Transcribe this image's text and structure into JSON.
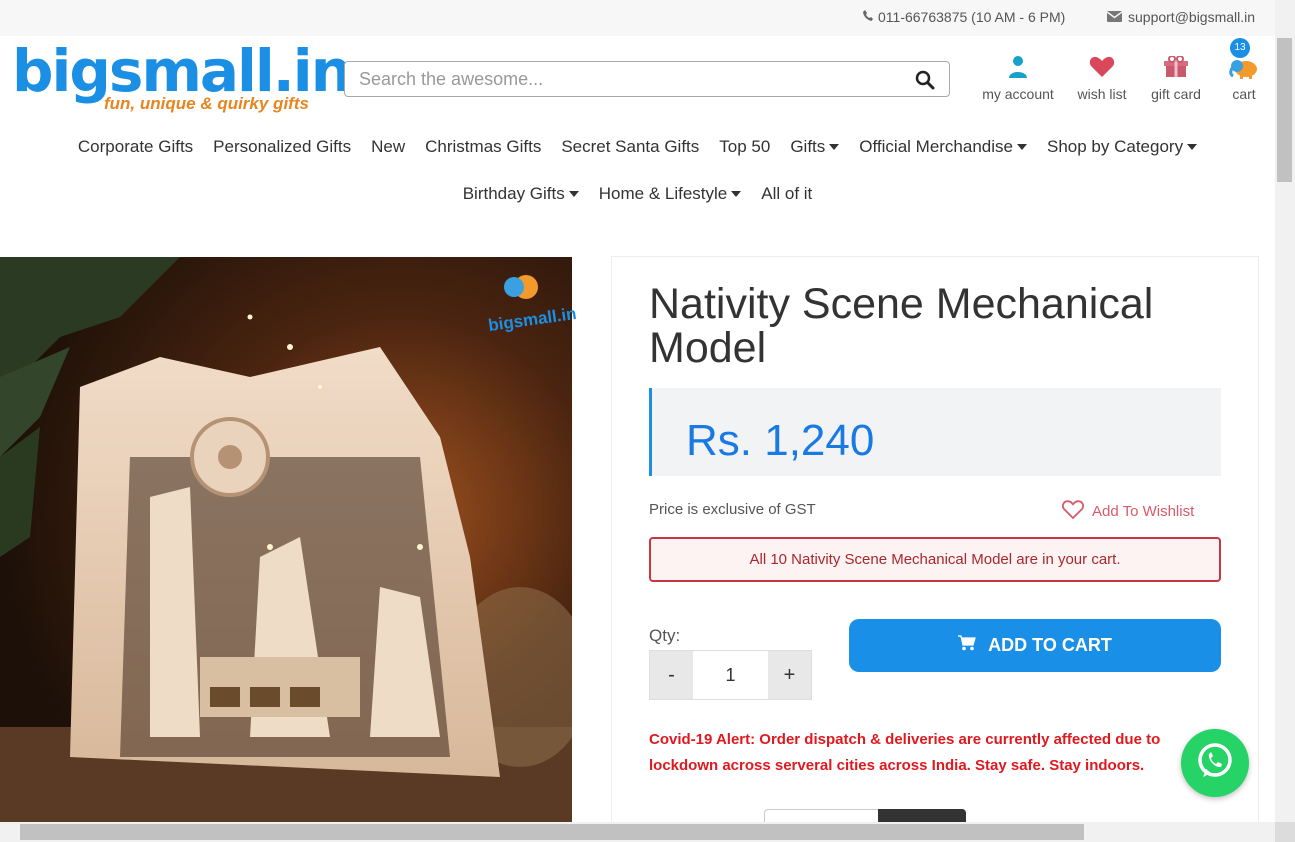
{
  "topbar": {
    "phone": "011-66763875 (10 AM - 6 PM)",
    "email": "support@bigsmall.in"
  },
  "logo": {
    "brand": "bigsmall.in",
    "tagline": "fun, unique & quirky gifts"
  },
  "search": {
    "placeholder": "Search the awesome..."
  },
  "header_icons": {
    "account": "my account",
    "wishlist": "wish list",
    "giftcard": "gift card",
    "cart": "cart",
    "cart_count": "13"
  },
  "nav": {
    "row1": [
      "Corporate Gifts",
      "Personalized Gifts",
      "New",
      "Christmas Gifts",
      "Secret Santa Gifts",
      "Top 50",
      "Gifts",
      "Official Merchandise",
      "Shop by Category"
    ],
    "row2": [
      "Birthday Gifts",
      "Home & Lifestyle",
      "All of it"
    ]
  },
  "product": {
    "image_watermark": "bigsmall.in",
    "title": "Nativity Scene Mechanical Model",
    "price": "Rs. 1,240",
    "gst_note": "Price is exclusive of GST",
    "wishlist": "Add To Wishlist",
    "cart_alert": "All 10 Nativity Scene Mechanical Model are in your cart.",
    "qty_label": "Qty:",
    "qty_minus": "-",
    "qty_value": "1",
    "qty_plus": "+",
    "add_to_cart": "ADD TO CART",
    "covid_alert": "Covid-19 Alert: Order dispatch & deliveries are currently affected due to lockdown across serveral cities across India. Stay safe. Stay indoors."
  },
  "colors": {
    "brand_blue": "#1a8fe3",
    "alert_red": "#e0191f",
    "whatsapp_green": "#25d366"
  }
}
